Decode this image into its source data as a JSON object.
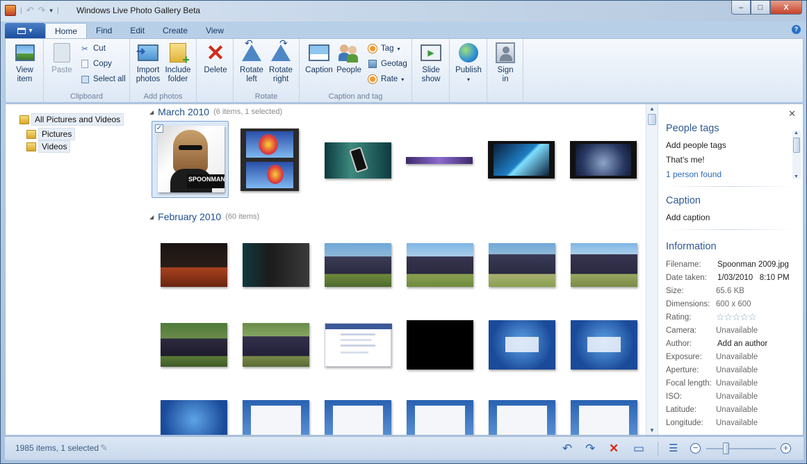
{
  "window": {
    "title": "Windows Live Photo Gallery Beta",
    "controls": {
      "minimize": "–",
      "maximize": "□",
      "close": "X"
    }
  },
  "ribbon_tabs": [
    "Home",
    "Find",
    "Edit",
    "Create",
    "View"
  ],
  "active_tab": "Home",
  "ribbon": {
    "view_item": [
      "View",
      "item"
    ],
    "clipboard": {
      "paste": "Paste",
      "cut": "Cut",
      "copy": "Copy",
      "select_all": "Select all",
      "label": "Clipboard"
    },
    "add_photos": {
      "import": [
        "Import",
        "photos"
      ],
      "include": [
        "Include",
        "folder"
      ],
      "label": "Add photos"
    },
    "delete": "Delete",
    "rotate": {
      "left": [
        "Rotate",
        "left"
      ],
      "right": [
        "Rotate",
        "right"
      ],
      "label": "Rotate"
    },
    "caption_tag": {
      "caption": "Caption",
      "people": "People",
      "tag": "Tag",
      "geotag": "Geotag",
      "rate": "Rate",
      "label": "Caption and tag"
    },
    "slideshow": [
      "Slide",
      "show"
    ],
    "publish": "Publish",
    "sign_in": [
      "Sign",
      "in"
    ]
  },
  "nav_tree": {
    "root": "All Pictures and Videos",
    "children": [
      "Pictures",
      "Videos"
    ]
  },
  "gallery": {
    "groups": [
      {
        "title": "March 2010",
        "subtitle": "(6 items, 1 selected)"
      },
      {
        "title": "February 2010",
        "subtitle": "(60 items)"
      }
    ],
    "featured_thumb_text": "SPOONMAN"
  },
  "side_panel": {
    "people_tags": {
      "title": "People tags",
      "add": "Add people tags",
      "thats_me": "That's me!",
      "found": "1 person found"
    },
    "caption": {
      "title": "Caption",
      "add": "Add caption"
    },
    "information": {
      "title": "Information",
      "rows": [
        {
          "key": "Filename:",
          "value": "Spoonman 2009.jpg"
        },
        {
          "key": "Date taken:",
          "value": "1/03/2010   8:10 PM"
        },
        {
          "key": "Size:",
          "value": "65.6 KB"
        },
        {
          "key": "Dimensions:",
          "value": "600 x 600"
        },
        {
          "key": "Rating:",
          "value": "☆☆☆☆☆"
        },
        {
          "key": "Camera:",
          "value": "Unavailable"
        },
        {
          "key": "Author:",
          "value": "Add an author"
        },
        {
          "key": "Exposure:",
          "value": "Unavailable"
        },
        {
          "key": "Aperture:",
          "value": "Unavailable"
        },
        {
          "key": "Focal length:",
          "value": "Unavailable"
        },
        {
          "key": "ISO:",
          "value": "Unavailable"
        },
        {
          "key": "Latitude:",
          "value": "Unavailable"
        },
        {
          "key": "Longitude:",
          "value": "Unavailable"
        }
      ]
    }
  },
  "status": {
    "text": "1985 items, 1 selected"
  }
}
